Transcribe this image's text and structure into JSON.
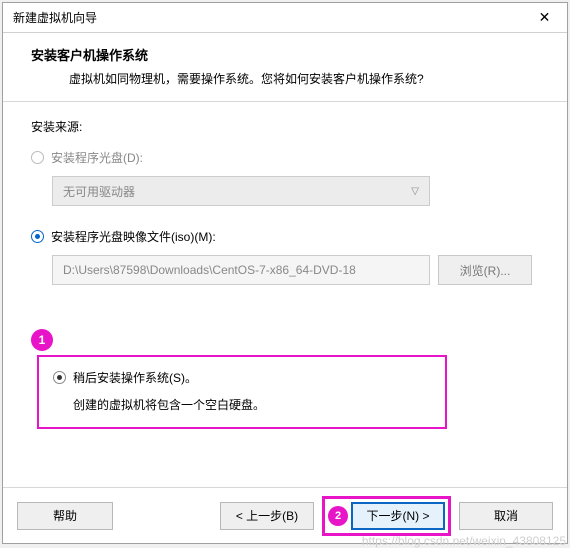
{
  "titlebar": {
    "title": "新建虚拟机向导"
  },
  "header": {
    "title": "安装客户机操作系统",
    "subtitle": "虚拟机如同物理机，需要操作系统。您将如何安装客户机操作系统?"
  },
  "source_label": "安装来源:",
  "option_disc": {
    "label": "安装程序光盘(D):",
    "dropdown": "无可用驱动器"
  },
  "option_iso": {
    "label": "安装程序光盘映像文件(iso)(M):",
    "path": "D:\\Users\\87598\\Downloads\\CentOS-7-x86_64-DVD-18",
    "browse": "浏览(R)..."
  },
  "option_later": {
    "label": "稍后安装操作系统(S)。",
    "desc": "创建的虚拟机将包含一个空白硬盘。"
  },
  "badges": {
    "one": "1",
    "two": "2"
  },
  "footer": {
    "help": "帮助",
    "back": "< 上一步(B)",
    "next": "下一步(N) >",
    "cancel": "取消"
  },
  "watermark": "https://blog.csdn.net/weixin_43808125"
}
